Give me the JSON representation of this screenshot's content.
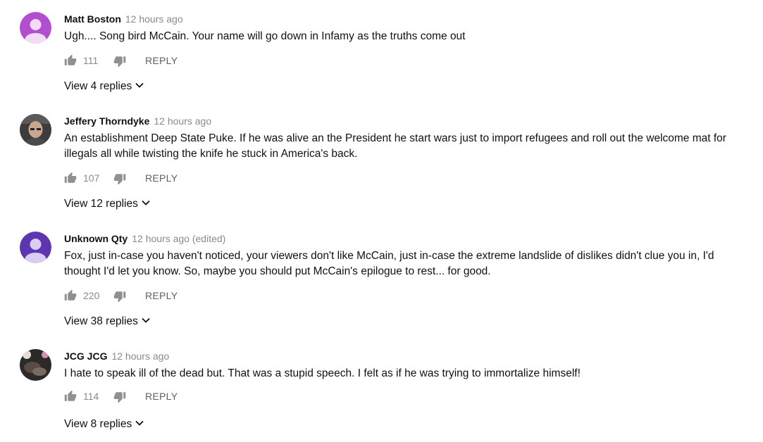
{
  "comments": [
    {
      "author": "Matt Boston",
      "time": "12 hours ago",
      "text": "Ugh.... Song bird McCain. Your name will go down in Infamy as the truths come out",
      "likes": "111",
      "reply_label": "REPLY",
      "view_replies": "View 4 replies",
      "avatar_color": "#b14fcf"
    },
    {
      "author": "Jeffery Thorndyke",
      "time": "12 hours ago",
      "text": "An establishment Deep State Puke. If he was alive an the President he start wars just to import refugees and roll out the welcome mat for illegals all while twisting the knife he stuck in America's back.",
      "likes": "107",
      "reply_label": "REPLY",
      "view_replies": "View 12 replies",
      "avatar_color": "#3c3c3c"
    },
    {
      "author": "Unknown Qty",
      "time": "12 hours ago (edited)",
      "text": "Fox, just in-case you haven't noticed, your viewers don't like McCain, just in-case the extreme landslide of dislikes didn't clue you in, I'd thought I'd let you know. So, maybe you should put McCain's epilogue to rest... for good.",
      "likes": "220",
      "reply_label": "REPLY",
      "view_replies": "View 38 replies",
      "avatar_color": "#5e35b1"
    },
    {
      "author": "JCG JCG",
      "time": "12 hours ago",
      "text": "I hate to speak ill of the dead but. That was a stupid speech. I felt as if he was trying to immortalize himself!",
      "likes": "114",
      "reply_label": "REPLY",
      "view_replies": "View 8 replies",
      "avatar_color": "#2a2a2a"
    }
  ]
}
